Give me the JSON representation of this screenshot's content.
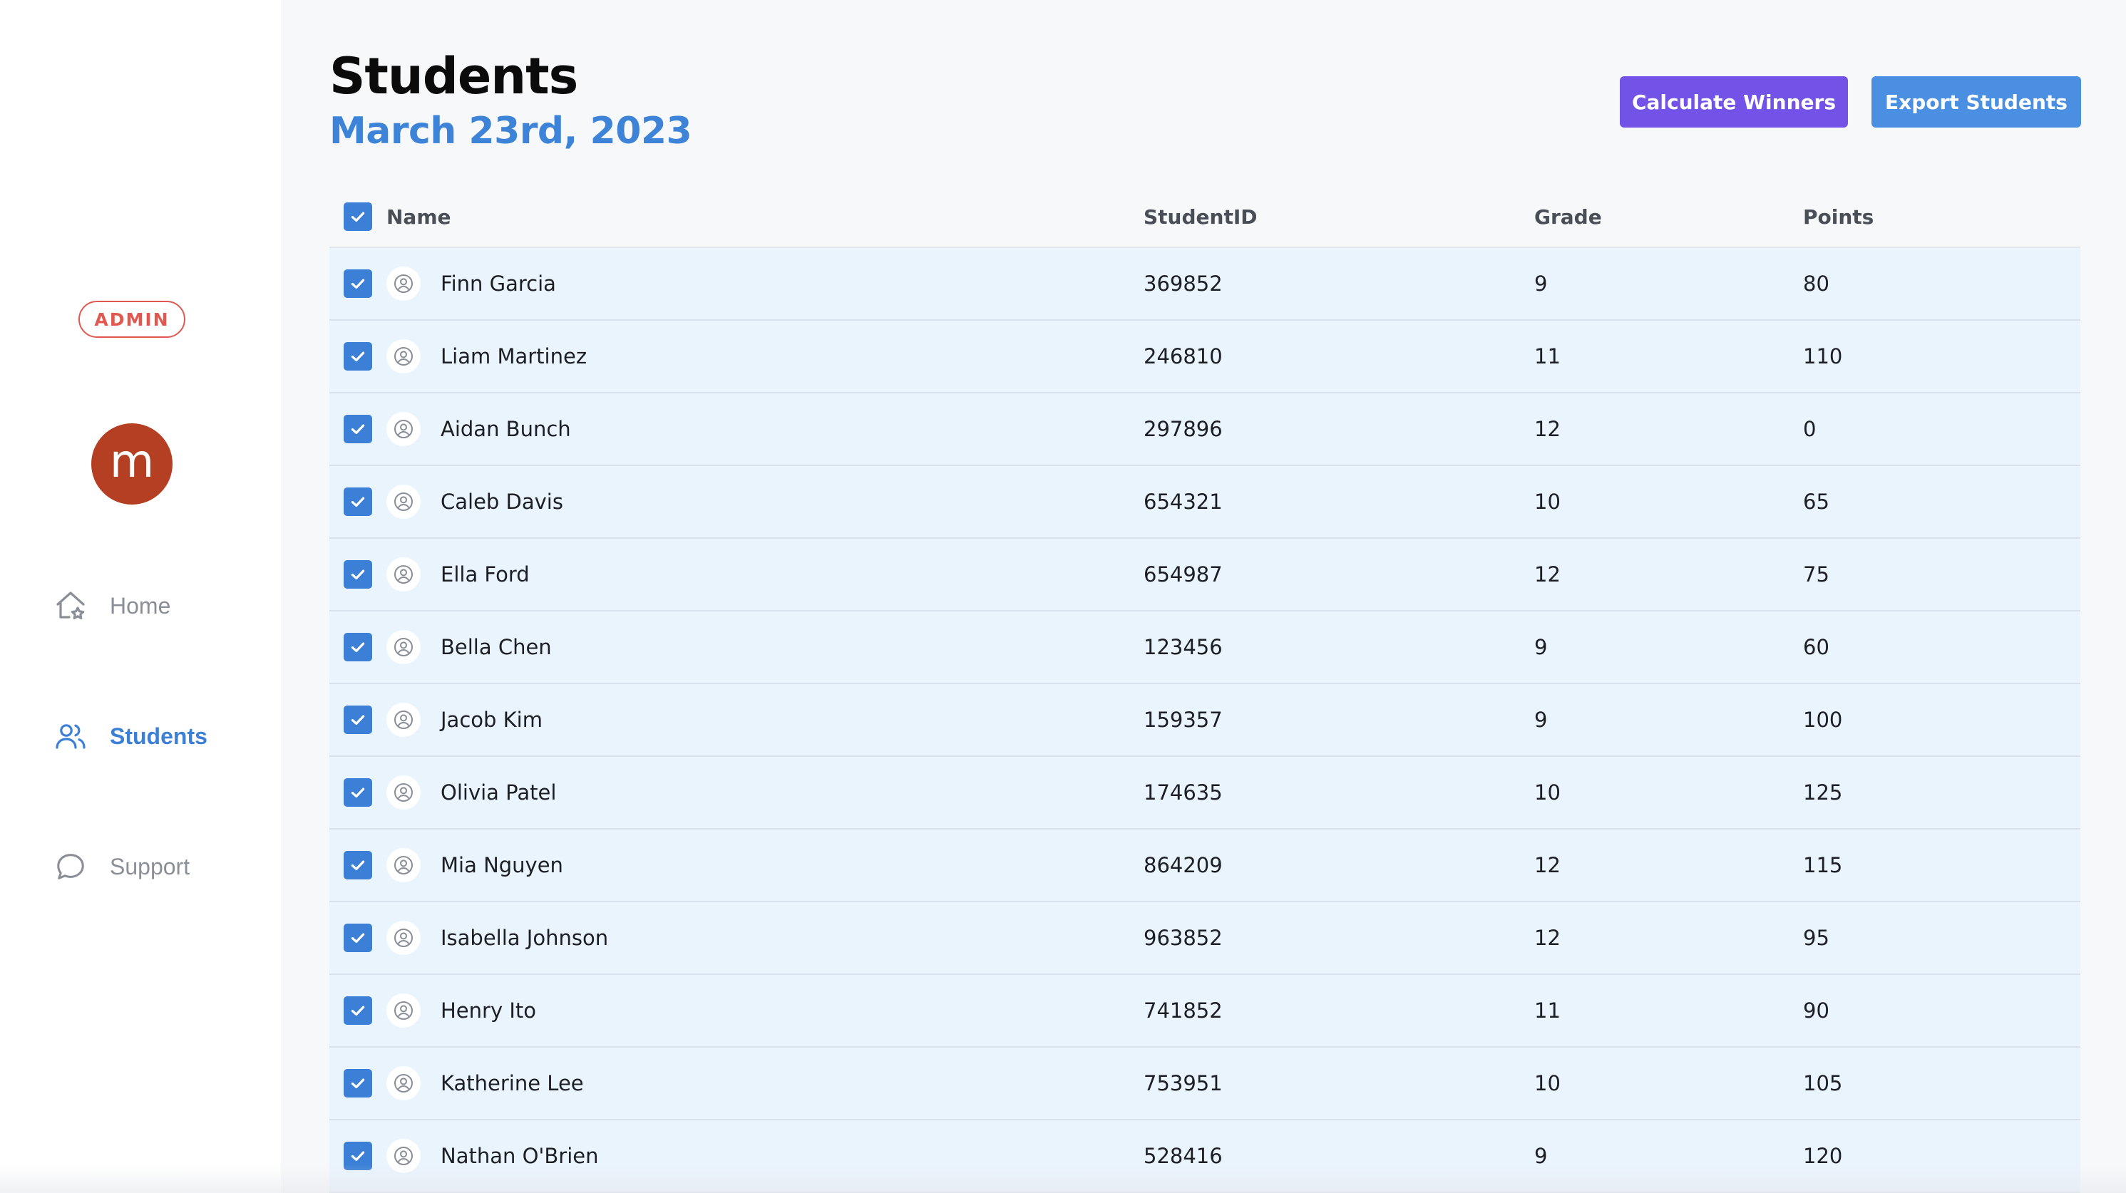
{
  "sidebar": {
    "badge": "ADMIN",
    "avatar_letter": "m",
    "nav": [
      {
        "label": "Home",
        "icon": "home-icon"
      },
      {
        "label": "Students",
        "icon": "users-icon"
      },
      {
        "label": "Support",
        "icon": "chat-bubble-icon"
      }
    ]
  },
  "header": {
    "title": "Students",
    "date": "March 23rd, 2023",
    "calc_button": "Calculate Winners",
    "export_button": "Export Students"
  },
  "table": {
    "columns": [
      "Name",
      "StudentID",
      "Grade",
      "Points"
    ],
    "rows": [
      {
        "name": "Finn Garcia",
        "id": "369852",
        "grade": "9",
        "points": "80"
      },
      {
        "name": "Liam Martinez",
        "id": "246810",
        "grade": "11",
        "points": "110"
      },
      {
        "name": "Aidan Bunch",
        "id": "297896",
        "grade": "12",
        "points": "0"
      },
      {
        "name": "Caleb Davis",
        "id": "654321",
        "grade": "10",
        "points": "65"
      },
      {
        "name": "Ella Ford",
        "id": "654987",
        "grade": "12",
        "points": "75"
      },
      {
        "name": "Bella Chen",
        "id": "123456",
        "grade": "9",
        "points": "60"
      },
      {
        "name": "Jacob Kim",
        "id": "159357",
        "grade": "9",
        "points": "100"
      },
      {
        "name": "Olivia Patel",
        "id": "174635",
        "grade": "10",
        "points": "125"
      },
      {
        "name": "Mia Nguyen",
        "id": "864209",
        "grade": "12",
        "points": "115"
      },
      {
        "name": "Isabella Johnson",
        "id": "963852",
        "grade": "12",
        "points": "95"
      },
      {
        "name": "Henry Ito",
        "id": "741852",
        "grade": "11",
        "points": "90"
      },
      {
        "name": "Katherine Lee",
        "id": "753951",
        "grade": "10",
        "points": "105"
      },
      {
        "name": "Nathan O'Brien",
        "id": "528416",
        "grade": "9",
        "points": "120"
      }
    ]
  },
  "colors": {
    "accent": "#3b7fd6",
    "calc_button": "#7352e8",
    "export_button": "#4a8fe2",
    "admin_badge": "#e0584f",
    "avatar": "#b43f22",
    "row_bg": "#eaf4fd"
  }
}
